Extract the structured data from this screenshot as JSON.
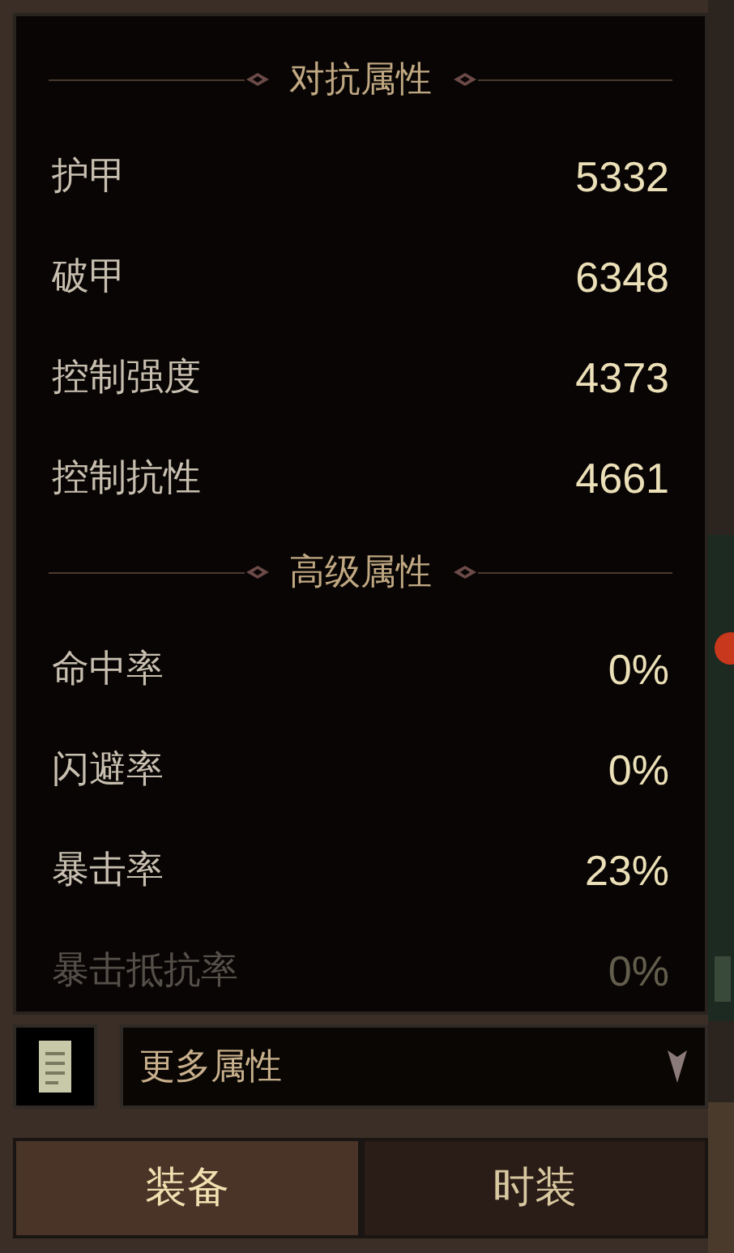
{
  "sections": [
    {
      "title": "对抗属性",
      "rows": [
        {
          "label": "护甲",
          "value": "5332",
          "faded": false
        },
        {
          "label": "破甲",
          "value": "6348",
          "faded": false
        },
        {
          "label": "控制强度",
          "value": "4373",
          "faded": false
        },
        {
          "label": "控制抗性",
          "value": "4661",
          "faded": false
        }
      ]
    },
    {
      "title": "高级属性",
      "rows": [
        {
          "label": "命中率",
          "value": "0%",
          "faded": false
        },
        {
          "label": "闪避率",
          "value": "0%",
          "faded": false
        },
        {
          "label": "暴击率",
          "value": "23%",
          "faded": false
        },
        {
          "label": "暴击抵抗率",
          "value": "0%",
          "faded": true
        }
      ]
    }
  ],
  "dropdown": {
    "value": "更多属性"
  },
  "tabs": [
    {
      "label": "装备",
      "selected": true
    },
    {
      "label": "时装",
      "selected": false
    }
  ]
}
